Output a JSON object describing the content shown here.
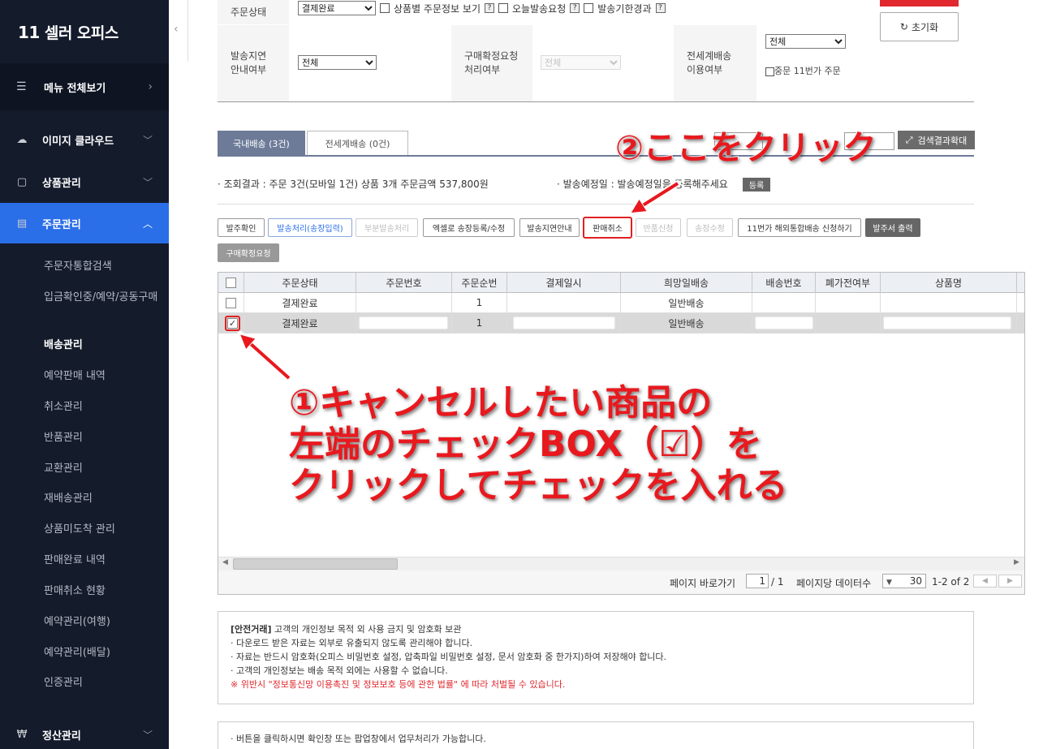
{
  "sidebar": {
    "logo_num": "11",
    "logo_text": "셀러 오피스",
    "menu_all": "메뉴 전체보기",
    "items": [
      {
        "label": "이미지 클라우드"
      },
      {
        "label": "상품관리"
      },
      {
        "label": "주문관리"
      }
    ],
    "sub_items": [
      "주문자통합검색",
      "입금확인중/예약/공동구매",
      "배송관리",
      "예약판매 내역",
      "취소관리",
      "반품관리",
      "교환관리",
      "재배송관리",
      "상품미도착 관리",
      "판매완료 내역",
      "판매취소 현황",
      "예약관리(여행)",
      "예약관리(배달)",
      "인증관리"
    ],
    "bottom_item": "정산관리"
  },
  "filter": {
    "order_status_label": "주문상태",
    "order_status_value": "결제완료",
    "opt_per_product": "상품별 주문정보 보기",
    "opt_today": "오늘발송요청",
    "opt_deadline": "발송기한경과",
    "delay_label": "발송지연\n안내여부",
    "delay_value": "전체",
    "confirm_label": "구매확정요청\n처리여부",
    "confirm_value": "전체",
    "global_label": "전세계배송\n이용여부",
    "global_value": "전체",
    "global_opt": "중문 11번가 주문",
    "reset": "초기화"
  },
  "tabs": {
    "domestic": "국내배송 (3건)",
    "global": "전세계배송 (0건)",
    "expand": "검색결과확대"
  },
  "summary": {
    "text": "조회결과 : 주문 3건(모바일 1건)   상품 3개   주문금액 537,800원",
    "ship_date": "발송예정일 : 발송예정일을 등록해주세요",
    "register": "등록"
  },
  "actions": [
    "발주확인",
    "발송처리(송장입력)",
    "부분발송처리",
    "엑셀로 송장등록/수정",
    "발송지연안내",
    "판매취소",
    "반품신청",
    "송장수정",
    "11번가 해외통합배송 신청하기",
    "발주서 출력",
    "구매확정요청"
  ],
  "grid": {
    "columns": [
      "주문상태",
      "주문번호",
      "주문순번",
      "결제일시",
      "희망일배송",
      "배송번호",
      "폐가전여부",
      "상품명"
    ],
    "rows": [
      {
        "status": "결제완료",
        "seq": "1",
        "delivery": "일반배송"
      },
      {
        "status": "결제완료",
        "seq": "1",
        "delivery": "일반배송"
      }
    ],
    "page_jump": "페이지 바로가기",
    "page_current": "1",
    "page_total": "/ 1",
    "per_page_label": "페이지당 데이터수",
    "per_page": "30",
    "range": "1-2 of 2"
  },
  "notice": {
    "title": "[안전거래]",
    "title_rest": " 고객의 개인정보 목적 외 사용 금지 및 암호화 보관",
    "lines": [
      "다운로드 받은 자료는 외부로 유출되지 않도록 관리해야 합니다.",
      "자료는 반드시 암호화(오피스 비밀번호 설정, 압축파일 비밀번호 설정, 문서 암호화 중 한가지)하여 저장해야 합니다.",
      "고객의 개인정보는 배송 목적 외에는 사용할 수 없습니다."
    ],
    "warning": "※ 위반시 \"정보통신망 이용촉진 및 정보보호 등에 관한 법률\" 에 따라 처벌될 수 있습니다.",
    "bottom": "버튼을 클릭하시면 확인창 또는 팝업창에서 업무처리가 가능합니다."
  },
  "annotations": {
    "step2": "②ここをクリック",
    "step1_line1": "①キャンセルしたい商品の",
    "step1_line2": "左端のチェックBOX（☑）を",
    "step1_line3": "クリックしてチェックを入れる"
  },
  "colors": {
    "sidebar_bg": "#141b2b",
    "active_nav": "#2a6ee8",
    "annotation": "#e8191e"
  }
}
